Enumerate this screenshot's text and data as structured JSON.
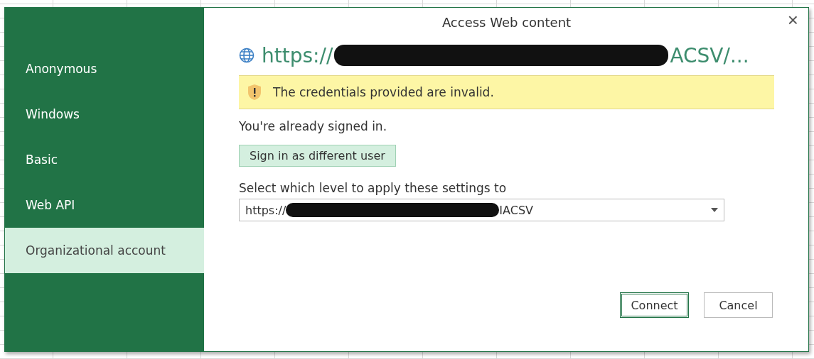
{
  "dialog": {
    "title": "Access Web content",
    "close": "×"
  },
  "sidebar": {
    "items": [
      {
        "label": "Anonymous",
        "selected": false
      },
      {
        "label": "Windows",
        "selected": false
      },
      {
        "label": "Basic",
        "selected": false
      },
      {
        "label": "Web API",
        "selected": false
      },
      {
        "label": "Organizational account",
        "selected": true
      }
    ]
  },
  "url": {
    "start": "https://",
    "end": "ACSV/..."
  },
  "warning": "The credentials provided are invalid.",
  "signed_in_text": "You're already signed in.",
  "sign_in_button": "Sign in as different user",
  "level": {
    "label": "Select which level to apply these settings to",
    "value_start": "https://",
    "value_end": "IACSV"
  },
  "buttons": [
    {
      "label": "Connect",
      "primary": true
    },
    {
      "label": "Cancel",
      "primary": false
    }
  ]
}
